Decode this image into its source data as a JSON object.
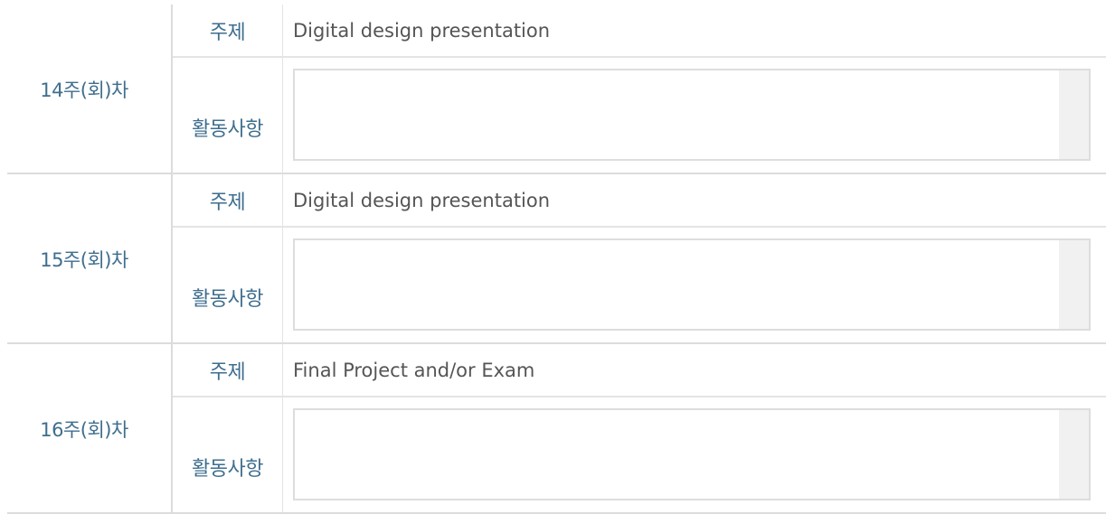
{
  "labels": {
    "topic": "주제",
    "activity": "활동사항"
  },
  "weeks": [
    {
      "label": "14주(회)차",
      "topic": "Digital design presentation",
      "activity": ""
    },
    {
      "label": "15주(회)차",
      "topic": "Digital design presentation",
      "activity": ""
    },
    {
      "label": "16주(회)차",
      "topic": "Final Project and/or Exam",
      "activity": ""
    }
  ],
  "colors": {
    "label_blue": "#3f6e8e",
    "text_gray": "#555555",
    "border": "#dcdcdc"
  }
}
